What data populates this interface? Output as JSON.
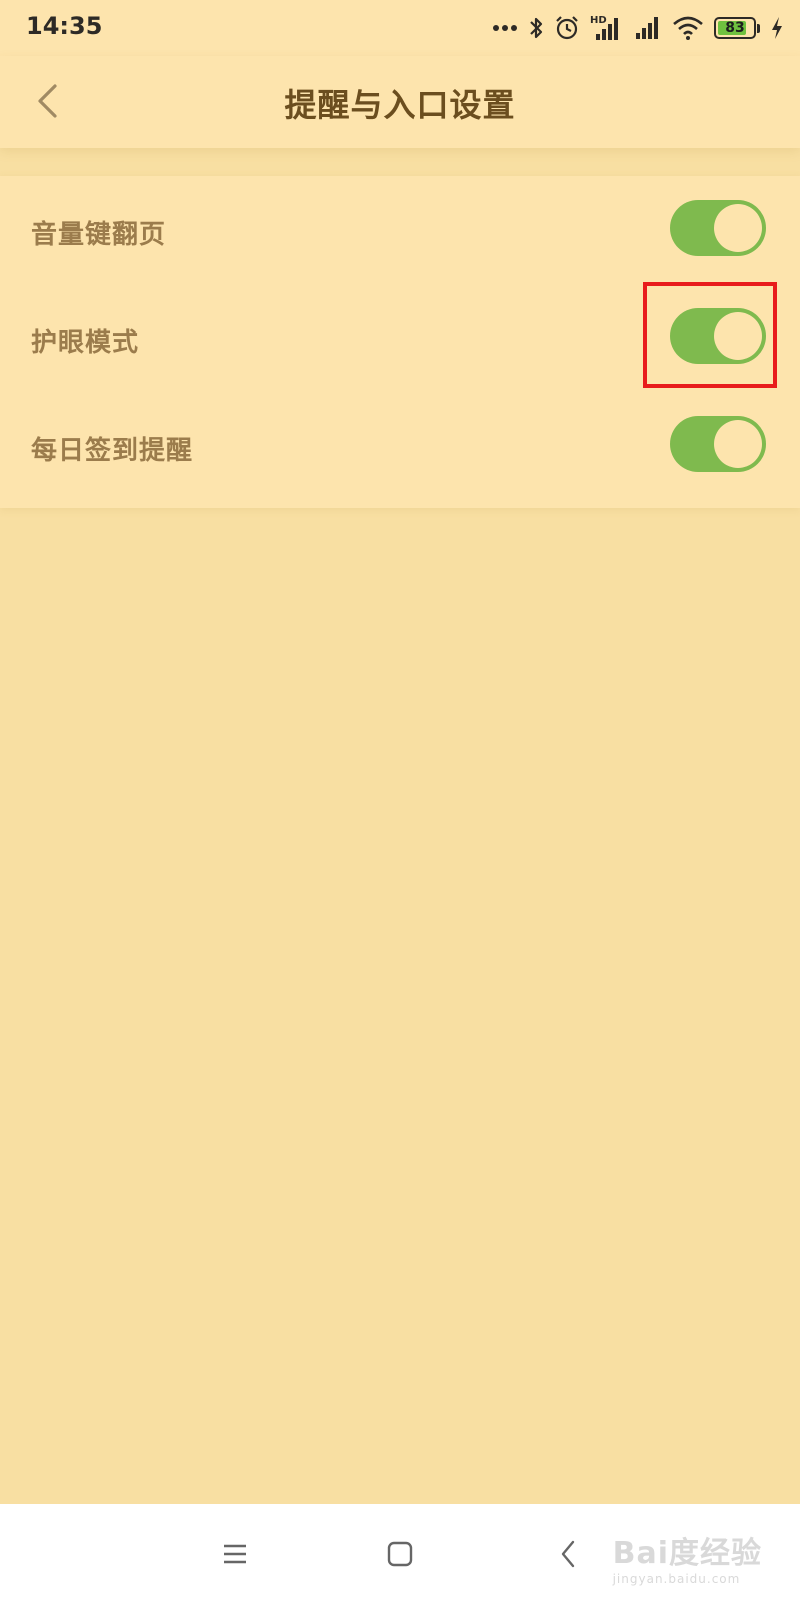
{
  "status_bar": {
    "time": "14:35",
    "battery_level": 83,
    "battery_text": "83",
    "icons": [
      "more-dots-icon",
      "bluetooth-icon",
      "alarm-icon",
      "hd-signal-icon",
      "signal-icon",
      "wifi-icon",
      "battery-icon",
      "charging-icon"
    ],
    "hd_label": "HD"
  },
  "header": {
    "title": "提醒与入口设置",
    "back_icon": "chevron-left-icon"
  },
  "settings": [
    {
      "label": "音量键翻页",
      "enabled": true
    },
    {
      "label": "护眼模式",
      "enabled": true
    },
    {
      "label": "每日签到提醒",
      "enabled": true
    }
  ],
  "nav_bar": {
    "buttons": [
      "menu-icon",
      "home-icon",
      "back-icon"
    ]
  },
  "watermark": {
    "main": "Bai度经验",
    "sub": "jingyan.baidu.com"
  },
  "colors": {
    "background": "#f8dfa2",
    "card": "#fde4ad",
    "toggle_on": "#7fba4e",
    "title": "#6b4e1f",
    "label": "#9b7c4c",
    "highlight": "#e81c1c"
  }
}
